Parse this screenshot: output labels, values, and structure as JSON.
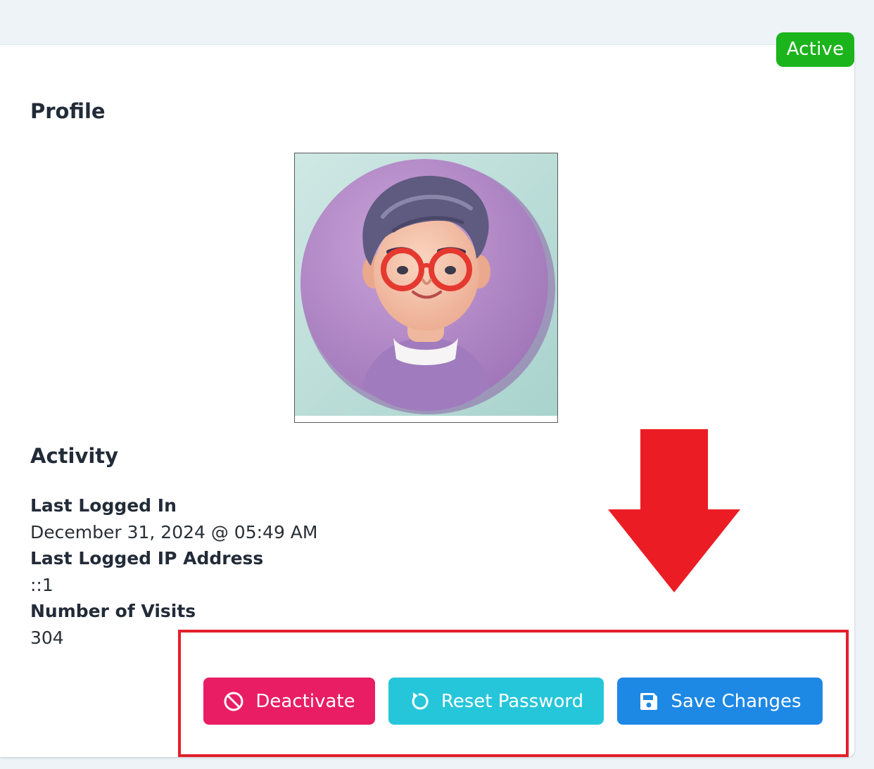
{
  "status": {
    "label": "Active",
    "color": "#1cb41c"
  },
  "profile": {
    "title": "Profile",
    "avatar_icon": "avatar-portrait-icon"
  },
  "activity": {
    "title": "Activity",
    "fields": [
      {
        "label": "Last Logged In",
        "value": "December 31, 2024 @ 05:49 AM"
      },
      {
        "label": "Last Logged IP Address",
        "value": "::1"
      },
      {
        "label": "Number of Visits",
        "value": "304"
      }
    ]
  },
  "actions": {
    "deactivate": {
      "label": "Deactivate",
      "icon": "ban-icon",
      "color": "#e91d63"
    },
    "reset_password": {
      "label": "Reset Password",
      "icon": "refresh-icon",
      "color": "#26c6da"
    },
    "save_changes": {
      "label": "Save Changes",
      "icon": "floppy-disk-icon",
      "color": "#1e88e5"
    }
  },
  "annotation": {
    "arrow": "down-arrow-icon",
    "highlight_color": "#e3202a"
  }
}
